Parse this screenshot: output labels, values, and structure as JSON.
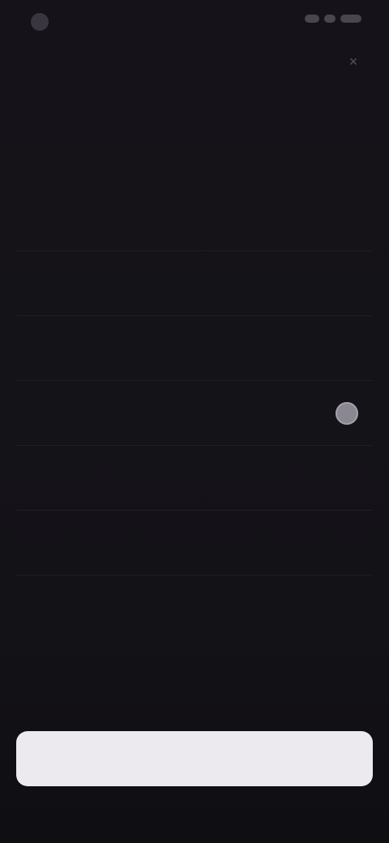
{
  "status_bar": {
    "left_text": "",
    "icons": [
      "signal-icon",
      "wifi-icon",
      "battery-icon"
    ]
  },
  "close": {
    "icon": "close-icon",
    "glyph": "×"
  },
  "title": "",
  "options": [
    {
      "label": "",
      "selected": false
    },
    {
      "label": "",
      "selected": false
    },
    {
      "label": "",
      "selected": false
    },
    {
      "label": "",
      "selected": true
    },
    {
      "label": "",
      "selected": false
    },
    {
      "label": "",
      "selected": false
    }
  ],
  "submit_button": {
    "label": ""
  },
  "colors": {
    "background": "#131217",
    "text": "#d8d5de",
    "muted_text": "#a9a5b0",
    "button_bg": "#ece9ef",
    "radio_selected": "#8a8790"
  }
}
